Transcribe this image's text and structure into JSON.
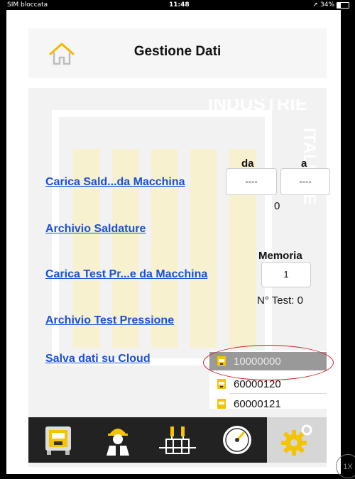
{
  "status_bar": {
    "carrier": "SIM bloccata",
    "time": "11:48",
    "battery": "34%"
  },
  "header": {
    "title": "Gestione Dati",
    "home_icon": "home-icon"
  },
  "main": {
    "carica_saldature": "Carica Sald...da Macchina",
    "archivio_saldature": "Archivio Saldature",
    "carica_test": "Carica Test Pr...e da Macchina",
    "archivio_test": "Archivio Test Pressione",
    "salva_cloud": "Salva dati su Cloud",
    "range": {
      "da_label": "da",
      "a_label": "a",
      "da_value": "----",
      "a_value": "----",
      "count": "0"
    },
    "memoria": {
      "label": "Memoria",
      "value": "1",
      "test_count": "N° Test: 0"
    },
    "watermark_text": [
      "INDUSTRIE",
      "ITALIANE"
    ]
  },
  "picker": {
    "items": [
      "10000000",
      "60000120",
      "60000121"
    ],
    "selected": "10000000"
  },
  "tabbar": {
    "tabs": [
      "welding-machine-icon",
      "worker-icon",
      "pipe-fitting-icon",
      "pressure-gauge-icon",
      "settings-gear-icon"
    ],
    "active": "settings-gear-icon"
  },
  "zoom": "1X",
  "colors": {
    "link": "#1a4fd6",
    "accent": "#f5c400",
    "tabbar": "#222222",
    "highlight": "#d8202a"
  }
}
